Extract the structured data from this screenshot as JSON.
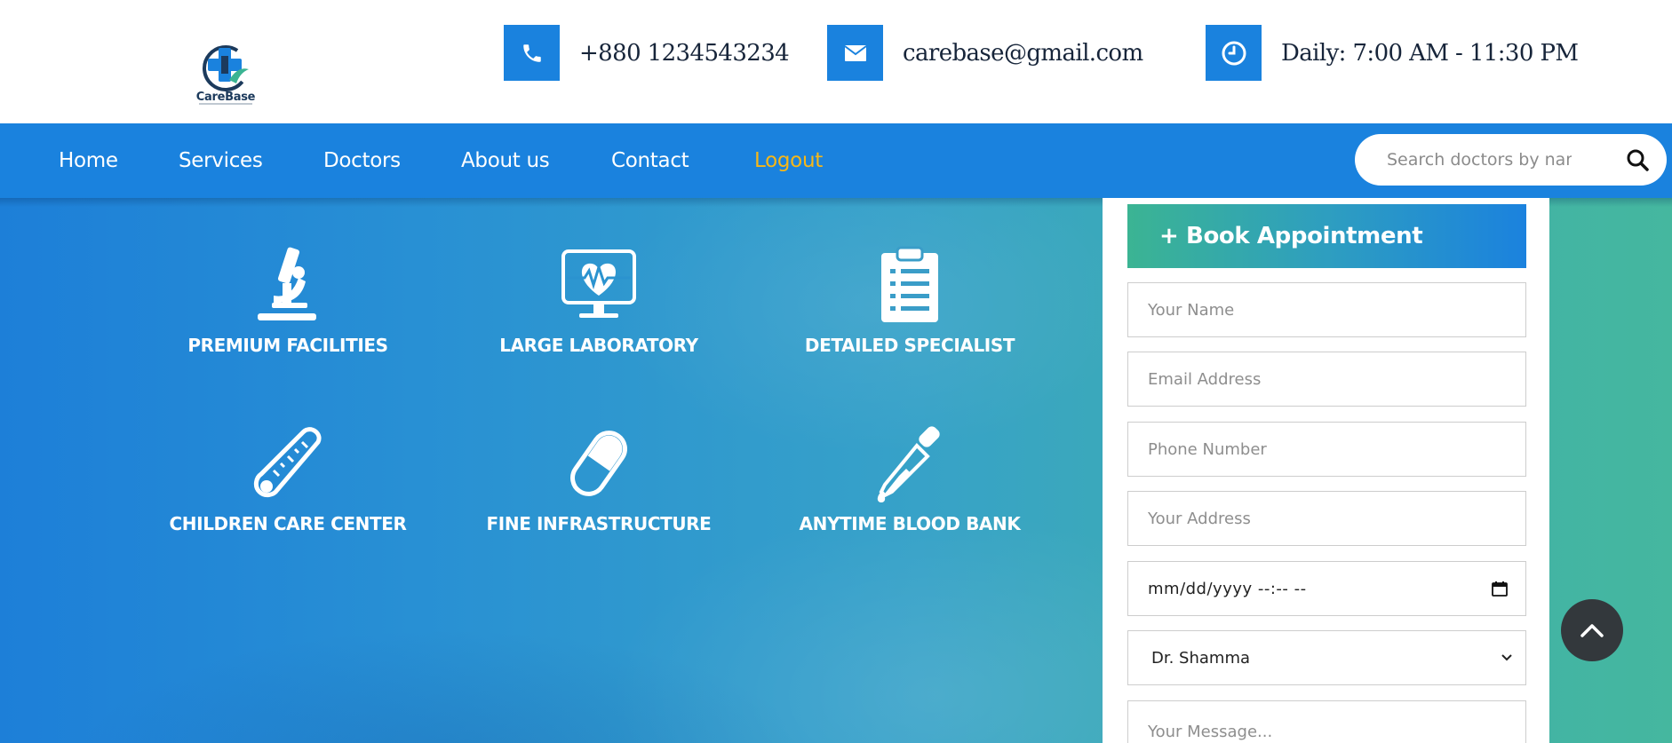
{
  "brand": {
    "name": "CareBase",
    "tagline": "HEALTHCARE SOLUTIONS"
  },
  "contact": {
    "phone": "+880 1234543234",
    "email": "carebase@gmail.com",
    "hours": "Daily: 7:00 AM - 11:30 PM"
  },
  "nav": {
    "items": [
      {
        "label": "Home"
      },
      {
        "label": "Services"
      },
      {
        "label": "Doctors"
      },
      {
        "label": "About us"
      },
      {
        "label": "Contact"
      },
      {
        "label": "Logout"
      }
    ],
    "search_placeholder": "Search doctors by name"
  },
  "features": [
    {
      "label": "PREMIUM FACILITIES",
      "icon": "microscope-icon"
    },
    {
      "label": "LARGE LABORATORY",
      "icon": "heart-monitor-icon"
    },
    {
      "label": "DETAILED SPECIALIST",
      "icon": "clipboard-icon"
    },
    {
      "label": "CHILDREN CARE CENTER",
      "icon": "thermometer-icon"
    },
    {
      "label": "FINE INFRASTRUCTURE",
      "icon": "pill-icon"
    },
    {
      "label": "ANYTIME BLOOD BANK",
      "icon": "dropper-icon"
    }
  ],
  "appointment": {
    "title": "+ Book Appointment",
    "name_placeholder": "Your Name",
    "email_placeholder": "Email Address",
    "phone_placeholder": "Phone Number",
    "address_placeholder": "Your Address",
    "datetime_value": "mm/dd/yyyy --:-- --",
    "doctor_selected": "Dr. Shamma",
    "message_placeholder": "Your Message..."
  },
  "colors": {
    "primary": "#1a82de",
    "accent_logout": "#f7b718",
    "scroll_button": "#33383c"
  }
}
